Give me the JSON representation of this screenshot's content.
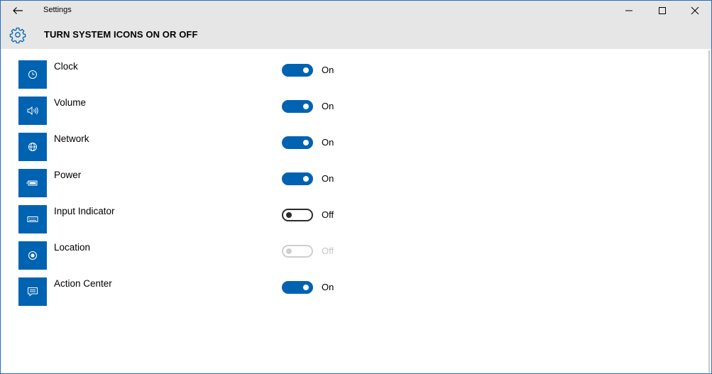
{
  "window": {
    "title": "Settings",
    "accent": "#0063b1"
  },
  "header": {
    "title": "TURN SYSTEM ICONS ON OR OFF"
  },
  "items": [
    {
      "label": "Clock",
      "icon": "clock-icon",
      "state": "On",
      "enabled": true
    },
    {
      "label": "Volume",
      "icon": "speaker-icon",
      "state": "On",
      "enabled": true
    },
    {
      "label": "Network",
      "icon": "globe-icon",
      "state": "On",
      "enabled": true
    },
    {
      "label": "Power",
      "icon": "battery-icon",
      "state": "On",
      "enabled": true
    },
    {
      "label": "Input Indicator",
      "icon": "keyboard-icon",
      "state": "Off",
      "enabled": true
    },
    {
      "label": "Location",
      "icon": "location-icon",
      "state": "Off",
      "enabled": false
    },
    {
      "label": "Action Center",
      "icon": "action-center-icon",
      "state": "On",
      "enabled": true
    }
  ]
}
